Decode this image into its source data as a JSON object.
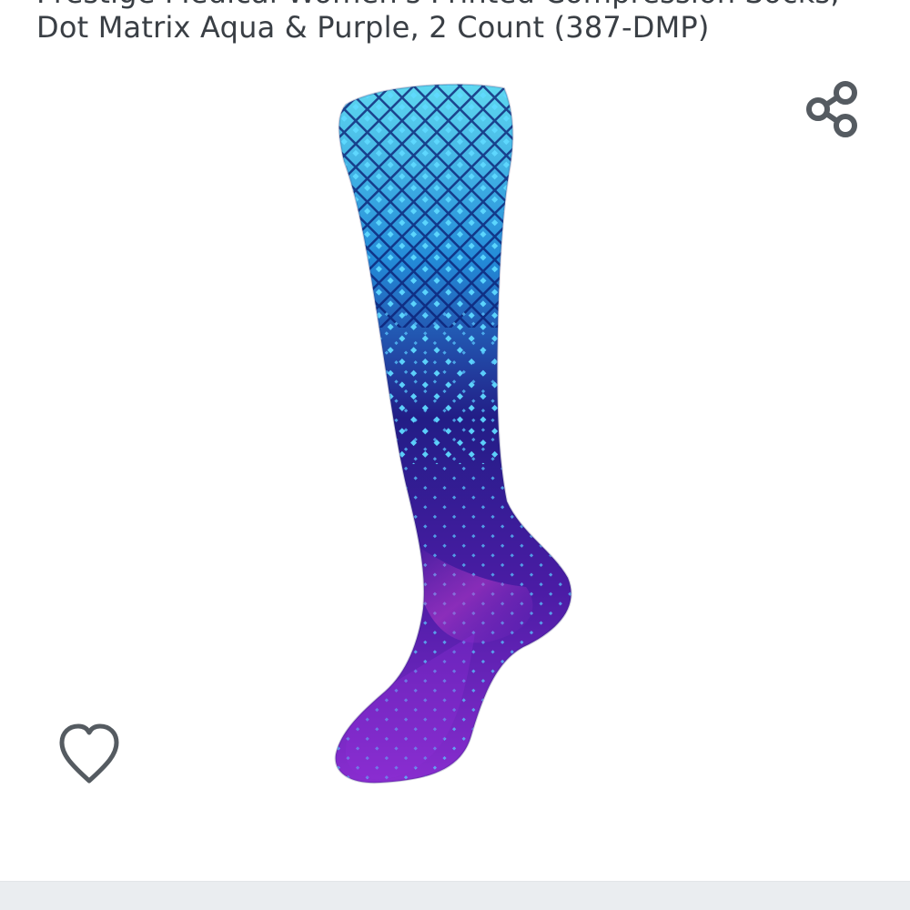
{
  "product": {
    "title_line_1": "Prestige Medical Women's Printed Compression Socks,",
    "title_line_2": "Dot Matrix Aqua & Purple, 2 Count (387-DMP)",
    "image_alt": "Dot Matrix Aqua & Purple compression sock"
  },
  "actions": {
    "share_icon": "share-icon",
    "wishlist_icon": "heart-outline-icon"
  },
  "colors": {
    "text": "#3a3f45",
    "icon": "#555b61",
    "sock_top": "#62d7ee",
    "sock_mid": "#26228c",
    "sock_bottom": "#8d2dd1",
    "divider": "#eaedf0"
  }
}
